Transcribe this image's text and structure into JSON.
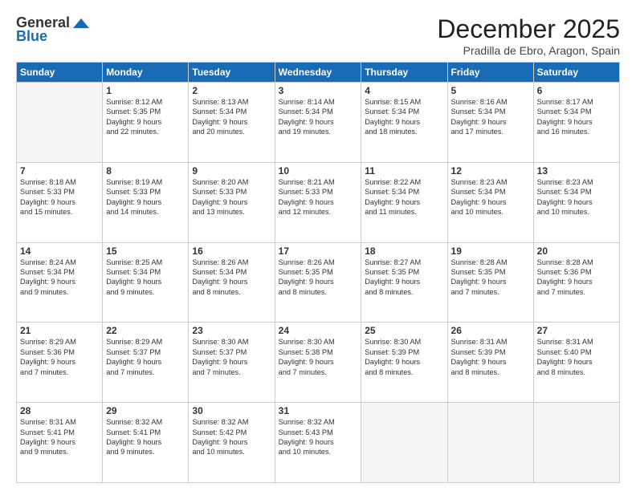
{
  "header": {
    "logo_general": "General",
    "logo_blue": "Blue",
    "month_title": "December 2025",
    "subtitle": "Pradilla de Ebro, Aragon, Spain"
  },
  "weekdays": [
    "Sunday",
    "Monday",
    "Tuesday",
    "Wednesday",
    "Thursday",
    "Friday",
    "Saturday"
  ],
  "weeks": [
    [
      {
        "day": "",
        "info": ""
      },
      {
        "day": "1",
        "info": "Sunrise: 8:12 AM\nSunset: 5:35 PM\nDaylight: 9 hours\nand 22 minutes."
      },
      {
        "day": "2",
        "info": "Sunrise: 8:13 AM\nSunset: 5:34 PM\nDaylight: 9 hours\nand 20 minutes."
      },
      {
        "day": "3",
        "info": "Sunrise: 8:14 AM\nSunset: 5:34 PM\nDaylight: 9 hours\nand 19 minutes."
      },
      {
        "day": "4",
        "info": "Sunrise: 8:15 AM\nSunset: 5:34 PM\nDaylight: 9 hours\nand 18 minutes."
      },
      {
        "day": "5",
        "info": "Sunrise: 8:16 AM\nSunset: 5:34 PM\nDaylight: 9 hours\nand 17 minutes."
      },
      {
        "day": "6",
        "info": "Sunrise: 8:17 AM\nSunset: 5:34 PM\nDaylight: 9 hours\nand 16 minutes."
      }
    ],
    [
      {
        "day": "7",
        "info": "Sunrise: 8:18 AM\nSunset: 5:33 PM\nDaylight: 9 hours\nand 15 minutes."
      },
      {
        "day": "8",
        "info": "Sunrise: 8:19 AM\nSunset: 5:33 PM\nDaylight: 9 hours\nand 14 minutes."
      },
      {
        "day": "9",
        "info": "Sunrise: 8:20 AM\nSunset: 5:33 PM\nDaylight: 9 hours\nand 13 minutes."
      },
      {
        "day": "10",
        "info": "Sunrise: 8:21 AM\nSunset: 5:33 PM\nDaylight: 9 hours\nand 12 minutes."
      },
      {
        "day": "11",
        "info": "Sunrise: 8:22 AM\nSunset: 5:34 PM\nDaylight: 9 hours\nand 11 minutes."
      },
      {
        "day": "12",
        "info": "Sunrise: 8:23 AM\nSunset: 5:34 PM\nDaylight: 9 hours\nand 10 minutes."
      },
      {
        "day": "13",
        "info": "Sunrise: 8:23 AM\nSunset: 5:34 PM\nDaylight: 9 hours\nand 10 minutes."
      }
    ],
    [
      {
        "day": "14",
        "info": "Sunrise: 8:24 AM\nSunset: 5:34 PM\nDaylight: 9 hours\nand 9 minutes."
      },
      {
        "day": "15",
        "info": "Sunrise: 8:25 AM\nSunset: 5:34 PM\nDaylight: 9 hours\nand 9 minutes."
      },
      {
        "day": "16",
        "info": "Sunrise: 8:26 AM\nSunset: 5:34 PM\nDaylight: 9 hours\nand 8 minutes."
      },
      {
        "day": "17",
        "info": "Sunrise: 8:26 AM\nSunset: 5:35 PM\nDaylight: 9 hours\nand 8 minutes."
      },
      {
        "day": "18",
        "info": "Sunrise: 8:27 AM\nSunset: 5:35 PM\nDaylight: 9 hours\nand 8 minutes."
      },
      {
        "day": "19",
        "info": "Sunrise: 8:28 AM\nSunset: 5:35 PM\nDaylight: 9 hours\nand 7 minutes."
      },
      {
        "day": "20",
        "info": "Sunrise: 8:28 AM\nSunset: 5:36 PM\nDaylight: 9 hours\nand 7 minutes."
      }
    ],
    [
      {
        "day": "21",
        "info": "Sunrise: 8:29 AM\nSunset: 5:36 PM\nDaylight: 9 hours\nand 7 minutes."
      },
      {
        "day": "22",
        "info": "Sunrise: 8:29 AM\nSunset: 5:37 PM\nDaylight: 9 hours\nand 7 minutes."
      },
      {
        "day": "23",
        "info": "Sunrise: 8:30 AM\nSunset: 5:37 PM\nDaylight: 9 hours\nand 7 minutes."
      },
      {
        "day": "24",
        "info": "Sunrise: 8:30 AM\nSunset: 5:38 PM\nDaylight: 9 hours\nand 7 minutes."
      },
      {
        "day": "25",
        "info": "Sunrise: 8:30 AM\nSunset: 5:39 PM\nDaylight: 9 hours\nand 8 minutes."
      },
      {
        "day": "26",
        "info": "Sunrise: 8:31 AM\nSunset: 5:39 PM\nDaylight: 9 hours\nand 8 minutes."
      },
      {
        "day": "27",
        "info": "Sunrise: 8:31 AM\nSunset: 5:40 PM\nDaylight: 9 hours\nand 8 minutes."
      }
    ],
    [
      {
        "day": "28",
        "info": "Sunrise: 8:31 AM\nSunset: 5:41 PM\nDaylight: 9 hours\nand 9 minutes."
      },
      {
        "day": "29",
        "info": "Sunrise: 8:32 AM\nSunset: 5:41 PM\nDaylight: 9 hours\nand 9 minutes."
      },
      {
        "day": "30",
        "info": "Sunrise: 8:32 AM\nSunset: 5:42 PM\nDaylight: 9 hours\nand 10 minutes."
      },
      {
        "day": "31",
        "info": "Sunrise: 8:32 AM\nSunset: 5:43 PM\nDaylight: 9 hours\nand 10 minutes."
      },
      {
        "day": "",
        "info": ""
      },
      {
        "day": "",
        "info": ""
      },
      {
        "day": "",
        "info": ""
      }
    ]
  ]
}
